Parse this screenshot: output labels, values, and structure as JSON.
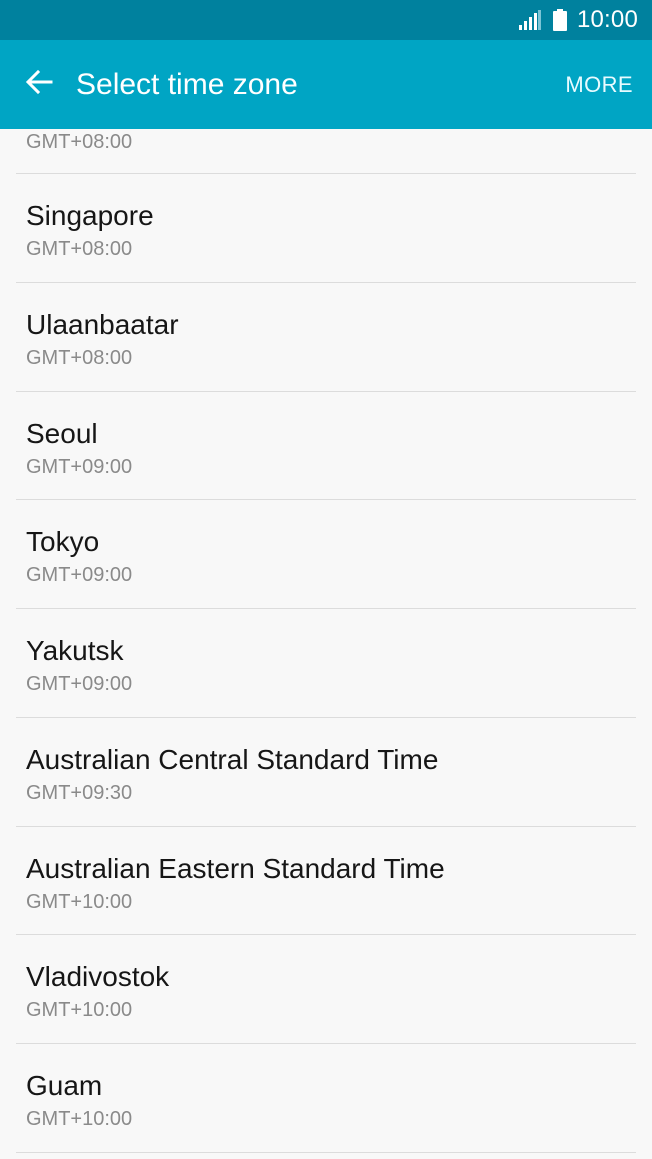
{
  "status_bar": {
    "time": "10:00",
    "icons": [
      "signal-icon",
      "battery-icon"
    ]
  },
  "app_bar": {
    "back_icon": "arrow-left-icon",
    "title": "Select time zone",
    "more_label": "MORE"
  },
  "colors": {
    "status_bar": "#00819e",
    "app_bar": "#00a5c4",
    "background": "#f8f8f8",
    "primary_text": "#161616",
    "secondary_text": "#8a8a8a",
    "divider": "#dcdcdc"
  },
  "list": {
    "partial_top_offset": "GMT+08:00",
    "items": [
      {
        "name": "Singapore",
        "offset": "GMT+08:00"
      },
      {
        "name": "Ulaanbaatar",
        "offset": "GMT+08:00"
      },
      {
        "name": "Seoul",
        "offset": "GMT+09:00"
      },
      {
        "name": "Tokyo",
        "offset": "GMT+09:00"
      },
      {
        "name": "Yakutsk",
        "offset": "GMT+09:00"
      },
      {
        "name": "Australian Central Standard Time",
        "offset": "GMT+09:30"
      },
      {
        "name": "Australian Eastern Standard Time",
        "offset": "GMT+10:00"
      },
      {
        "name": "Vladivostok",
        "offset": "GMT+10:00"
      },
      {
        "name": "Guam",
        "offset": "GMT+10:00"
      }
    ]
  }
}
